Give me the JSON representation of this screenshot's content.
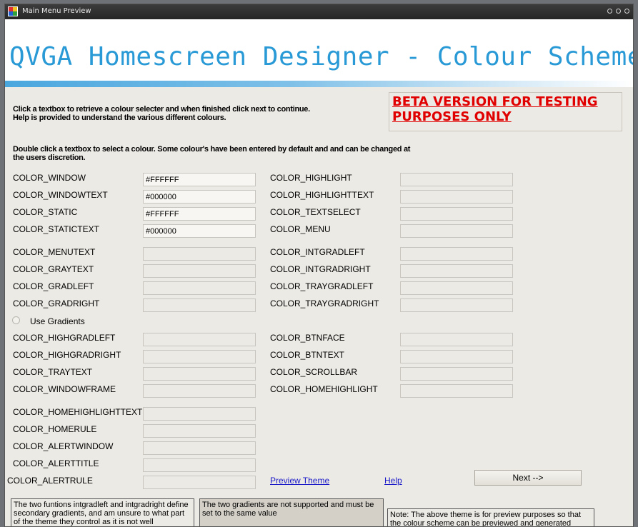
{
  "window": {
    "title": "Main Menu Preview"
  },
  "banner": {
    "title": "QVGA Homescreen Designer - Colour Scheme"
  },
  "instructions": {
    "line1": "Click a textbox to retrieve a colour selecter and when finished click next to continue.",
    "line2": "Help is provided to understand the various different colours.",
    "double_click_line1": "Double click a textbox to select a colour. Some colour's have been entered by default and and can be changed at",
    "double_click_line2": "the users discretion."
  },
  "beta": {
    "line1": "BETA VERSION FOR TESTING",
    "line2": "PURPOSES ONLY"
  },
  "colors_left": [
    {
      "label": "COLOR_WINDOW",
      "value": "#FFFFFF"
    },
    {
      "label": "COLOR_WINDOWTEXT",
      "value": "#000000"
    },
    {
      "label": "COLOR_STATIC",
      "value": "#FFFFFF"
    },
    {
      "label": "COLOR_STATICTEXT",
      "value": "#000000"
    },
    {
      "label": "COLOR_MENUTEXT",
      "value": ""
    },
    {
      "label": "COLOR_GRAYTEXT",
      "value": ""
    },
    {
      "label": "COLOR_GRADLEFT",
      "value": ""
    },
    {
      "label": "COLOR_GRADRIGHT",
      "value": ""
    },
    {
      "label": "COLOR_HIGHGRADLEFT",
      "value": ""
    },
    {
      "label": "COLOR_HIGHGRADRIGHT",
      "value": ""
    },
    {
      "label": "COLOR_TRAYTEXT",
      "value": ""
    },
    {
      "label": "COLOR_WINDOWFRAME",
      "value": ""
    },
    {
      "label": "COLOR_HOMEHIGHLIGHTTEXT",
      "value": ""
    },
    {
      "label": "COLOR_HOMERULE",
      "value": ""
    },
    {
      "label": "COLOR_ALERTWINDOW",
      "value": ""
    },
    {
      "label": "COLOR_ALERTTITLE",
      "value": ""
    },
    {
      "label": "COLOR_ALERTRULE",
      "value": ""
    }
  ],
  "colors_right": [
    {
      "label": "COLOR_HIGHLIGHT",
      "value": ""
    },
    {
      "label": "COLOR_HIGHLIGHTTEXT",
      "value": ""
    },
    {
      "label": "COLOR_TEXTSELECT",
      "value": ""
    },
    {
      "label": "COLOR_MENU",
      "value": ""
    },
    {
      "label": "COLOR_INTGRADLEFT",
      "value": ""
    },
    {
      "label": "COLOR_INTGRADRIGHT",
      "value": ""
    },
    {
      "label": "COLOR_TRAYGRADLEFT",
      "value": ""
    },
    {
      "label": "COLOR_TRAYGRADRIGHT",
      "value": ""
    },
    {
      "label": "COLOR_BTNFACE",
      "value": ""
    },
    {
      "label": "COLOR_BTNTEXT",
      "value": ""
    },
    {
      "label": "COLOR_SCROLLBAR",
      "value": ""
    },
    {
      "label": "COLOR_HOMEHIGHLIGHT",
      "value": ""
    }
  ],
  "use_gradients_label": "Use Gradients",
  "links": {
    "preview_theme": "Preview Theme",
    "help": "Help"
  },
  "next_button": "Next -->",
  "notes": {
    "note1": "The two funtions intgradleft and intgradright define secondary gradients, and am unsure to what part of the theme they control as it is not well",
    "note2": "The two gradients are not supported and must be set to the same value",
    "note3": "Note: The above theme is for preview purposes so that the colour scheme can be previewed and generated"
  },
  "colors": {
    "banner_text": "#2a9ad6",
    "beta_text": "#e00000",
    "link": "#1818c8",
    "window_bg": "#eceae5"
  }
}
